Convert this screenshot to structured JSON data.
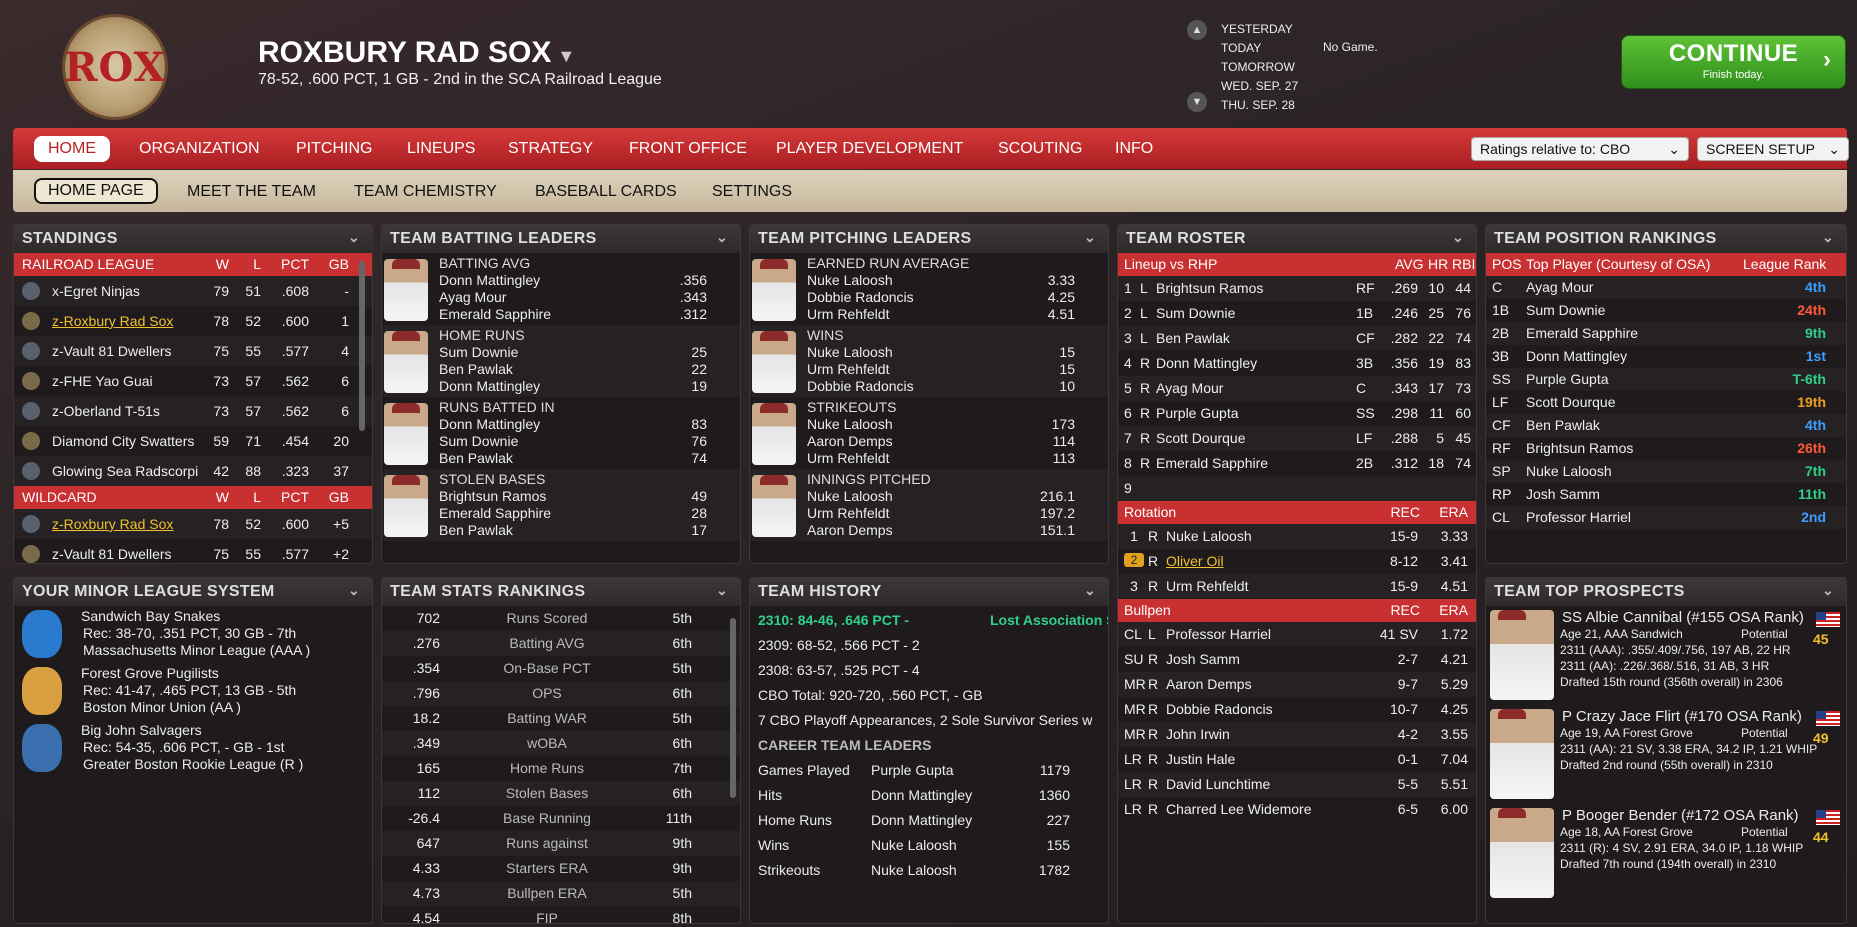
{
  "header": {
    "logo_text": "ROX",
    "team_name": "ROXBURY RAD SOX",
    "record_line": "78-52, .600 PCT, 1 GB - 2nd in the SCA Railroad League",
    "dates": [
      "YESTERDAY",
      "TODAY",
      "TOMORROW",
      "WED. SEP. 27",
      "THU. SEP. 28"
    ],
    "today_game": "No Game.",
    "continue_label": "CONTINUE",
    "continue_sub": "Finish today."
  },
  "nav": {
    "main": [
      "HOME",
      "ORGANIZATION",
      "PITCHING",
      "LINEUPS",
      "STRATEGY",
      "FRONT OFFICE",
      "PLAYER DEVELOPMENT",
      "SCOUTING",
      "INFO"
    ],
    "ratings_select": "Ratings relative to: CBO",
    "screen_setup": "SCREEN SETUP",
    "sub": [
      "HOME PAGE",
      "MEET THE TEAM",
      "TEAM CHEMISTRY",
      "BASEBALL CARDS",
      "SETTINGS"
    ]
  },
  "standings": {
    "title": "STANDINGS",
    "league_header": [
      "RAILROAD LEAGUE",
      "W",
      "L",
      "PCT",
      "GB"
    ],
    "league_rows": [
      [
        "x-Egret Ninjas",
        "79",
        "51",
        ".608",
        "-"
      ],
      [
        "z-Roxbury Rad Sox",
        "78",
        "52",
        ".600",
        "1"
      ],
      [
        "z-Vault 81 Dwellers",
        "75",
        "55",
        ".577",
        "4"
      ],
      [
        "z-FHE Yao Guai",
        "73",
        "57",
        ".562",
        "6"
      ],
      [
        "z-Oberland T-51s",
        "73",
        "57",
        ".562",
        "6"
      ],
      [
        "Diamond City Swatters",
        "59",
        "71",
        ".454",
        "20"
      ],
      [
        "Glowing Sea Radscorpi",
        "42",
        "88",
        ".323",
        "37"
      ]
    ],
    "wildcard_header": [
      "WILDCARD",
      "W",
      "L",
      "PCT",
      "GB"
    ],
    "wildcard_rows": [
      [
        "z-Roxbury Rad Sox",
        "78",
        "52",
        ".600",
        "+5"
      ],
      [
        "z-Vault 81 Dwellers",
        "75",
        "55",
        ".577",
        "+2"
      ]
    ]
  },
  "batting": {
    "title": "TEAM BATTING LEADERS",
    "groups": [
      {
        "cat": "BATTING AVG",
        "rows": [
          [
            "Donn Mattingley",
            ".356"
          ],
          [
            "Ayag Mour",
            ".343"
          ],
          [
            "Emerald Sapphire",
            ".312"
          ]
        ]
      },
      {
        "cat": "HOME RUNS",
        "rows": [
          [
            "Sum Downie",
            "25"
          ],
          [
            "Ben Pawlak",
            "22"
          ],
          [
            "Donn Mattingley",
            "19"
          ]
        ]
      },
      {
        "cat": "RUNS BATTED IN",
        "rows": [
          [
            "Donn Mattingley",
            "83"
          ],
          [
            "Sum Downie",
            "76"
          ],
          [
            "Ben Pawlak",
            "74"
          ]
        ]
      },
      {
        "cat": "STOLEN BASES",
        "rows": [
          [
            "Brightsun Ramos",
            "49"
          ],
          [
            "Emerald Sapphire",
            "28"
          ],
          [
            "Ben Pawlak",
            "17"
          ]
        ]
      }
    ]
  },
  "pitching": {
    "title": "TEAM PITCHING LEADERS",
    "groups": [
      {
        "cat": "EARNED RUN AVERAGE",
        "rows": [
          [
            "Nuke Laloosh",
            "3.33"
          ],
          [
            "Dobbie Radoncis",
            "4.25"
          ],
          [
            "Urm Rehfeldt",
            "4.51"
          ]
        ]
      },
      {
        "cat": "WINS",
        "rows": [
          [
            "Nuke Laloosh",
            "15"
          ],
          [
            "Urm Rehfeldt",
            "15"
          ],
          [
            "Dobbie Radoncis",
            "10"
          ]
        ]
      },
      {
        "cat": "STRIKEOUTS",
        "rows": [
          [
            "Nuke Laloosh",
            "173"
          ],
          [
            "Aaron Demps",
            "114"
          ],
          [
            "Urm Rehfeldt",
            "113"
          ]
        ]
      },
      {
        "cat": "INNINGS PITCHED",
        "rows": [
          [
            "Nuke Laloosh",
            "216.1"
          ],
          [
            "Urm Rehfeldt",
            "197.2"
          ],
          [
            "Aaron Demps",
            "151.1"
          ]
        ]
      }
    ]
  },
  "roster": {
    "title": "TEAM ROSTER",
    "lineup_header": [
      "Lineup vs RHP",
      "AVG",
      "HR",
      "RBI"
    ],
    "lineup": [
      [
        "1",
        "L",
        "Brightsun Ramos",
        "RF",
        ".269",
        "10",
        "44"
      ],
      [
        "2",
        "L",
        "Sum Downie",
        "1B",
        ".246",
        "25",
        "76"
      ],
      [
        "3",
        "L",
        "Ben Pawlak",
        "CF",
        ".282",
        "22",
        "74"
      ],
      [
        "4",
        "R",
        "Donn Mattingley",
        "3B",
        ".356",
        "19",
        "83"
      ],
      [
        "5",
        "R",
        "Ayag Mour",
        "C",
        ".343",
        "17",
        "73"
      ],
      [
        "6",
        "R",
        "Purple Gupta",
        "SS",
        ".298",
        "11",
        "60"
      ],
      [
        "7",
        "R",
        "Scott Dourque",
        "LF",
        ".288",
        "5",
        "45"
      ],
      [
        "8",
        "R",
        "Emerald Sapphire",
        "2B",
        ".312",
        "18",
        "74"
      ],
      [
        "9",
        "",
        "",
        "",
        "",
        "",
        ""
      ]
    ],
    "rotation_header": [
      "Rotation",
      "REC",
      "ERA"
    ],
    "rotation": [
      [
        "1",
        "R",
        "Nuke Laloosh",
        "15-9",
        "3.33"
      ],
      [
        "2",
        "R",
        "Oliver Oil",
        "8-12",
        "3.41"
      ],
      [
        "3",
        "R",
        "Urm Rehfeldt",
        "15-9",
        "4.51"
      ]
    ],
    "bullpen_header": [
      "Bullpen",
      "REC",
      "ERA"
    ],
    "bullpen": [
      [
        "CL",
        "L",
        "Professor Harriel",
        "41 SV",
        "1.72"
      ],
      [
        "SU",
        "R",
        "Josh Samm",
        "2-7",
        "4.21"
      ],
      [
        "MR",
        "R",
        "Aaron Demps",
        "9-7",
        "5.29"
      ],
      [
        "MR",
        "R",
        "Dobbie Radoncis",
        "10-7",
        "4.25"
      ],
      [
        "MR",
        "R",
        "John Irwin",
        "4-2",
        "3.55"
      ],
      [
        "LR",
        "R",
        "Justin Hale",
        "0-1",
        "7.04"
      ],
      [
        "LR",
        "R",
        "David Lunchtime",
        "5-5",
        "5.51"
      ],
      [
        "LR",
        "R",
        "Charred Lee Widemore",
        "6-5",
        "6.00"
      ]
    ]
  },
  "positions": {
    "title": "TEAM POSITION RANKINGS",
    "header": [
      "POS",
      "Top Player (Courtesy of OSA)",
      "League Rank"
    ],
    "rows": [
      [
        "C",
        "Ayag Mour",
        "4th",
        "#3aa0ff"
      ],
      [
        "1B",
        "Sum Downie",
        "24th",
        "#ff5a3c"
      ],
      [
        "2B",
        "Emerald Sapphire",
        "9th",
        "#2fd08a"
      ],
      [
        "3B",
        "Donn Mattingley",
        "1st",
        "#3aa0ff"
      ],
      [
        "SS",
        "Purple Gupta",
        "T-6th",
        "#2fd08a"
      ],
      [
        "LF",
        "Scott Dourque",
        "19th",
        "#f0a020"
      ],
      [
        "CF",
        "Ben Pawlak",
        "4th",
        "#3aa0ff"
      ],
      [
        "RF",
        "Brightsun Ramos",
        "26th",
        "#ff5a3c"
      ],
      [
        "SP",
        "Nuke Laloosh",
        "7th",
        "#2fd08a"
      ],
      [
        "RP",
        "Josh Samm",
        "11th",
        "#2fd08a"
      ],
      [
        "CL",
        "Professor Harriel",
        "2nd",
        "#3aa0ff"
      ]
    ]
  },
  "minors": {
    "title": "YOUR MINOR LEAGUE SYSTEM",
    "teams": [
      {
        "name": "Sandwich Bay Snakes",
        "rec": "Rec: 38-70, .351 PCT, 30 GB - 7th",
        "league": "Massachusetts Minor League (AAA )"
      },
      {
        "name": "Forest Grove Pugilists",
        "rec": "Rec: 41-47, .465 PCT, 13 GB - 5th",
        "league": "Boston Minor Union (AA )"
      },
      {
        "name": "Big John Salvagers",
        "rec": "Rec: 54-35, .606 PCT, - GB - 1st",
        "league": "Greater Boston Rookie League (R )"
      }
    ]
  },
  "stats": {
    "title": "TEAM STATS RANKINGS",
    "rows": [
      [
        "702",
        "Runs Scored",
        "5th"
      ],
      [
        ".276",
        "Batting AVG",
        "6th"
      ],
      [
        ".354",
        "On-Base PCT",
        "5th"
      ],
      [
        ".796",
        "OPS",
        "6th"
      ],
      [
        "18.2",
        "Batting WAR",
        "5th"
      ],
      [
        ".349",
        "wOBA",
        "6th"
      ],
      [
        "165",
        "Home Runs",
        "7th"
      ],
      [
        "112",
        "Stolen Bases",
        "6th"
      ],
      [
        "-26.4",
        "Base Running",
        "11th"
      ],
      [
        "647",
        "Runs against",
        "9th"
      ],
      [
        "4.33",
        "Starters ERA",
        "9th"
      ],
      [
        "4.73",
        "Bullpen ERA",
        "5th"
      ],
      [
        "4.54",
        "FIP",
        "8th"
      ]
    ]
  },
  "history": {
    "title": "TEAM HISTORY",
    "line1": "2310: 84-46, .646 PCT -",
    "line1_b": "Lost Association S",
    "line2": "2309: 68-52, .566 PCT - 2",
    "line3": "2308: 63-57, .525 PCT - 4",
    "line4": "CBO Total: 920-720, .560 PCT, - GB",
    "line5": "7 CBO Playoff Appearances, 2 Sole Survivor Series w",
    "leaders_title": "CAREER TEAM LEADERS",
    "leaders": [
      [
        "Games Played",
        "Purple Gupta",
        "1179"
      ],
      [
        "Hits",
        "Donn Mattingley",
        "1360"
      ],
      [
        "Home Runs",
        "Donn Mattingley",
        "227"
      ],
      [
        "Wins",
        "Nuke Laloosh",
        "155"
      ],
      [
        "Strikeouts",
        "Nuke Laloosh",
        "1782"
      ]
    ]
  },
  "prospects": {
    "title": "TEAM TOP PROSPECTS",
    "items": [
      {
        "name": "SS Albie Cannibal (#155 OSA Rank)",
        "age": "Age 21, AAA Sandwich",
        "pot_label": "Potential",
        "pot": "45",
        "l1": "2311 (AAA): .355/.409/.756, 197 AB, 22 HR",
        "l2": "2311 (AA): .226/.368/.516, 31 AB, 3 HR",
        "l3": "Drafted 15th round (356th overall) in 2306"
      },
      {
        "name": "P Crazy Jace Flirt (#170 OSA Rank)",
        "age": "Age 19, AA Forest Grove",
        "pot_label": "Potential",
        "pot": "49",
        "l1": "2311 (AA): 21 SV, 3.38 ERA, 34.2 IP, 1.21 WHIP",
        "l2": "Drafted 2nd round (55th overall) in 2310",
        "l3": ""
      },
      {
        "name": "P Booger Bender (#172 OSA Rank)",
        "age": "Age 18, AA Forest Grove",
        "pot_label": "Potential",
        "pot": "44",
        "l1": "2311 (R): 4 SV, 2.91 ERA, 34.0 IP, 1.18 WHIP",
        "l2": "Drafted 7th round (194th overall) in 2310",
        "l3": ""
      }
    ]
  },
  "colors": {
    "accent_red": "#c83032",
    "continue_green": "#3fa626",
    "link_gold": "#f0c030"
  }
}
